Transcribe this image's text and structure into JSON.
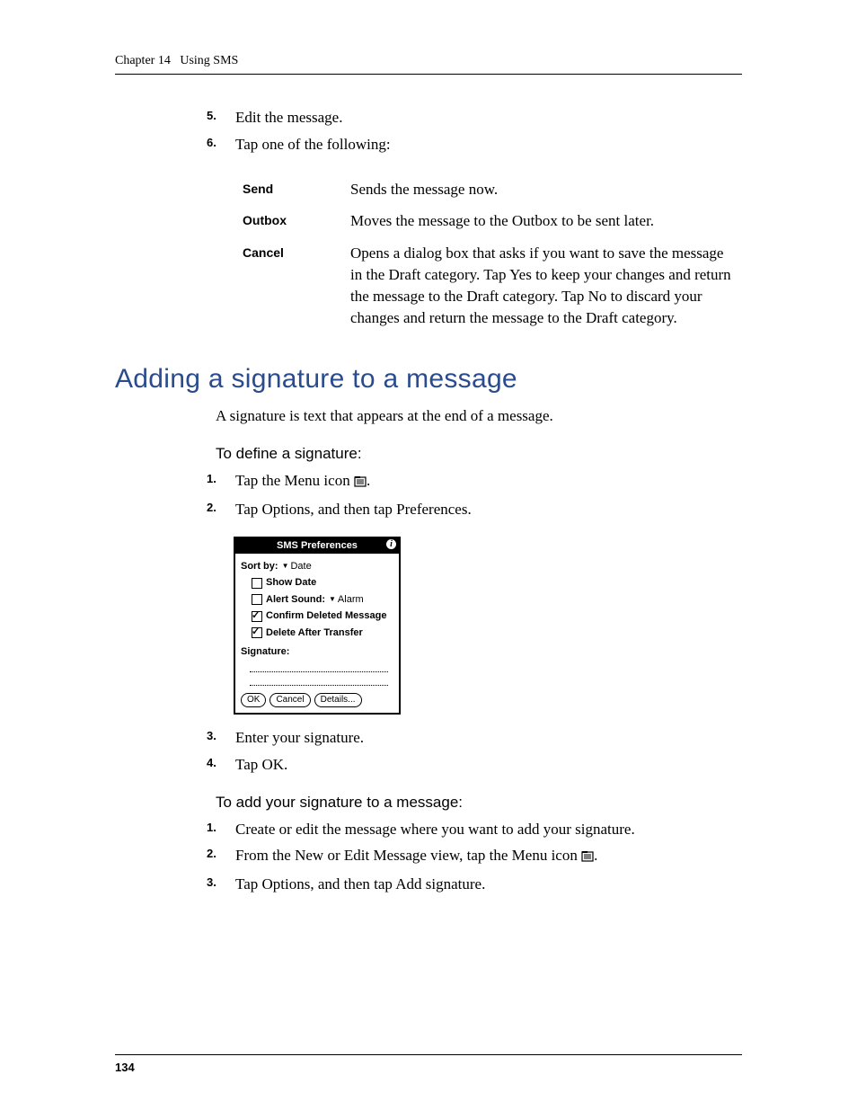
{
  "header": {
    "chapter_label": "Chapter 14",
    "chapter_title": "Using SMS"
  },
  "steps_top": {
    "items": [
      {
        "num": "5.",
        "text": "Edit the message."
      },
      {
        "num": "6.",
        "text": "Tap one of the following:"
      }
    ]
  },
  "option_table": {
    "rows": [
      {
        "term": "Send",
        "desc": "Sends the message now."
      },
      {
        "term": "Outbox",
        "desc": "Moves the message to the Outbox to be sent later."
      },
      {
        "term": "Cancel",
        "desc": "Opens a dialog box that asks if you want to save the message in the Draft category. Tap Yes to keep your changes and return the message to the Draft category. Tap No to discard your changes and return the message to the Draft category."
      }
    ]
  },
  "section": {
    "title": "Adding a signature to a message",
    "intro": "A signature is text that appears at the end of a message."
  },
  "define_sig": {
    "heading": "To define a signature:",
    "steps": [
      {
        "num": "1.",
        "prefix": "Tap the Menu icon ",
        "suffix": "."
      },
      {
        "num": "2.",
        "text": "Tap Options, and then tap Preferences."
      },
      {
        "num": "3.",
        "text": "Enter your signature."
      },
      {
        "num": "4.",
        "text": "Tap OK."
      }
    ]
  },
  "palm_dialog": {
    "title": "SMS Preferences",
    "sort_label": "Sort by:",
    "sort_value": "Date",
    "show_date_label": "Show Date",
    "show_date_checked": false,
    "alert_label": "Alert Sound:",
    "alert_value": "Alarm",
    "alert_checked": false,
    "confirm_label": "Confirm Deleted Message",
    "confirm_checked": true,
    "delete_label": "Delete After Transfer",
    "delete_checked": true,
    "signature_label": "Signature:",
    "buttons": {
      "ok": "OK",
      "cancel": "Cancel",
      "details": "Details..."
    }
  },
  "add_sig": {
    "heading": "To add your signature to a message:",
    "steps": [
      {
        "num": "1.",
        "text": "Create or edit the message where you want to add your signature."
      },
      {
        "num": "2.",
        "prefix": "From the New or Edit Message view, tap the Menu icon ",
        "suffix": "."
      },
      {
        "num": "3.",
        "text": "Tap Options, and then tap Add signature."
      }
    ]
  },
  "page_number": "134"
}
